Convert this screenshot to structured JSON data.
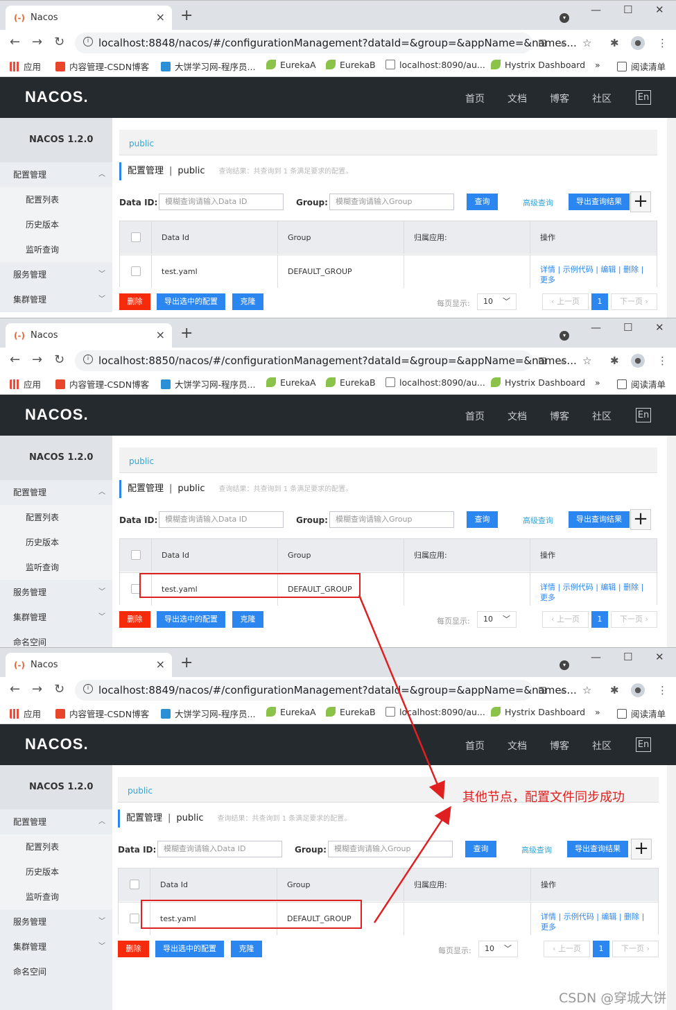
{
  "tab_title": "Nacos",
  "urls": [
    "localhost:8848/nacos/#/configurationManagement?dataId=&group=&appName=&names...",
    "localhost:8850/nacos/#/configurationManagement?dataId=&group=&appName=&names...",
    "localhost:8849/nacos/#/configurationManagement?dataId=&group=&appName=&names..."
  ],
  "bookmarks": [
    "应用",
    "内容管理-CSDN博客",
    "大饼学习网-程序员...",
    "EurekaA",
    "EurekaB",
    "localhost:8090/au...",
    "Hystrix Dashboard",
    "»",
    "阅读清单"
  ],
  "topnav": {
    "logo": "NACOS.",
    "items": [
      "首页",
      "文档",
      "博客",
      "社区"
    ],
    "lang": "En"
  },
  "sidebar": {
    "version": "NACOS 1.2.0",
    "items": [
      "配置管理",
      "配置列表",
      "历史版本",
      "监听查询",
      "服务管理",
      "集群管理",
      "命名空间"
    ]
  },
  "main": {
    "breadcrumb": "public",
    "title": "配置管理",
    "separator": "|",
    "namespace": "public",
    "result": "查询结果：共查询到 1 条满足要求的配置。",
    "dataid_label": "Data ID:",
    "dataid_placeholder": "模糊查询请输入Data ID",
    "group_label": "Group:",
    "group_placeholder": "模糊查询请输入Group",
    "query": "查询",
    "advanced": "高级查询",
    "export": "导出查询结果",
    "plus": "+",
    "table": {
      "headers": [
        "Data Id",
        "Group",
        "归属应用:",
        "操作"
      ],
      "row": {
        "data_id": "test.yaml",
        "group": "DEFAULT_GROUP",
        "app": "",
        "ops": "详情 | 示例代码 | 编辑 | 删除 | 更多"
      }
    },
    "delete": "删除",
    "export_selected": "导出选中的配置",
    "clone": "克隆",
    "per_page_label": "每页显示:",
    "per_page": "10",
    "prev": "上一页",
    "page": "1",
    "next": "下一页"
  },
  "annotation": "其他节点，配置文件同步成功",
  "watermark": "CSDN @穿城大饼",
  "colors": {
    "accent": "#2c86f0",
    "danger": "#f52b0b",
    "annot": "#e02020",
    "topbar": "#252a2f"
  }
}
